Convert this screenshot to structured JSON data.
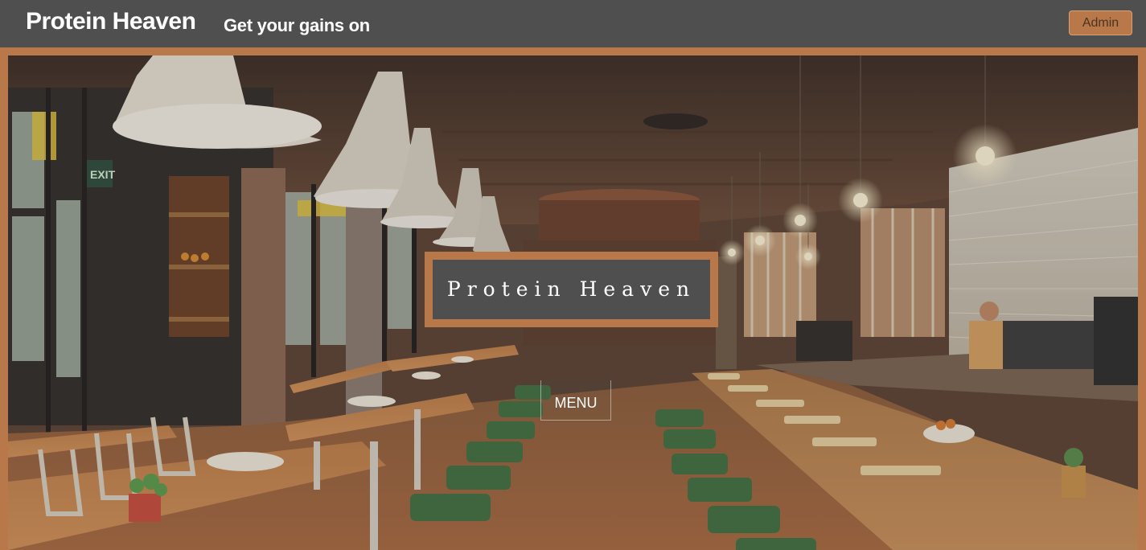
{
  "header": {
    "brand": "Protein Heaven",
    "tagline": "Get your gains on",
    "admin_label": "Admin"
  },
  "hero": {
    "title": "Protein Heaven",
    "menu_label": "MENU",
    "image_subject": "restaurant-interior-photo"
  },
  "colors": {
    "header_bg": "#4f4f4f",
    "accent": "#b9784a",
    "text": "#ffffff"
  }
}
